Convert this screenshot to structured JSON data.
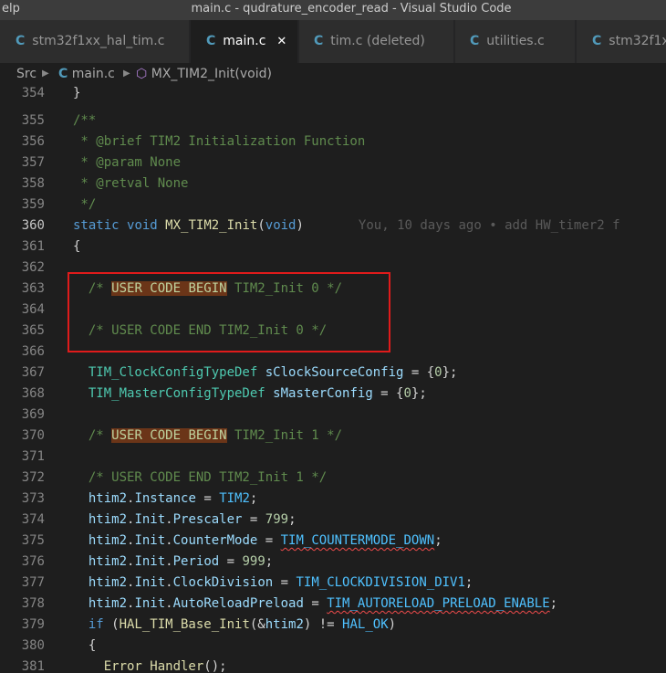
{
  "titlebar": {
    "menu_fragment": "elp",
    "window_title": "main.c - qudrature_encoder_read - Visual Studio Code"
  },
  "tabs": [
    {
      "label": "stm32f1xx_hal_tim.c",
      "active": false
    },
    {
      "label": "main.c",
      "active": true,
      "close": "✕"
    },
    {
      "label": "tim.c (deleted)",
      "active": false
    },
    {
      "label": "utilities.c",
      "active": false
    },
    {
      "label": "stm32f1x",
      "active": false
    }
  ],
  "breadcrumb": {
    "folder": "Src",
    "file": "main.c",
    "symbol": "MX_TIM2_Init(void)"
  },
  "icons": {
    "file_icon": "c-file-icon",
    "symbol_icon": "method-cube-icon",
    "separator": "chevron-right-icon"
  },
  "editor": {
    "current_line": "360",
    "blame": "You, 10 days ago • add HW_timer2 f",
    "lines": [
      {
        "n": "354",
        "text": "}"
      },
      {
        "n": "355",
        "text": "/**"
      },
      {
        "n": "356",
        "text": " * @brief TIM2 Initialization Function"
      },
      {
        "n": "357",
        "text": " * @param None"
      },
      {
        "n": "358",
        "text": " * @retval None"
      },
      {
        "n": "359",
        "text": " */"
      },
      {
        "n": "360",
        "text": "static void MX_TIM2_Init(void)"
      },
      {
        "n": "361",
        "text": "{"
      },
      {
        "n": "362",
        "text": ""
      },
      {
        "n": "363",
        "text": "  /* USER CODE BEGIN TIM2_Init 0 */"
      },
      {
        "n": "364",
        "text": ""
      },
      {
        "n": "365",
        "text": "  /* USER CODE END TIM2_Init 0 */"
      },
      {
        "n": "366",
        "text": ""
      },
      {
        "n": "367",
        "text": "  TIM_ClockConfigTypeDef sClockSourceConfig = {0};"
      },
      {
        "n": "368",
        "text": "  TIM_MasterConfigTypeDef sMasterConfig = {0};"
      },
      {
        "n": "369",
        "text": ""
      },
      {
        "n": "370",
        "text": "  /* USER CODE BEGIN TIM2_Init 1 */"
      },
      {
        "n": "371",
        "text": ""
      },
      {
        "n": "372",
        "text": "  /* USER CODE END TIM2_Init 1 */"
      },
      {
        "n": "373",
        "text": "  htim2.Instance = TIM2;"
      },
      {
        "n": "374",
        "text": "  htim2.Init.Prescaler = 799;"
      },
      {
        "n": "375",
        "text": "  htim2.Init.CounterMode = TIM_COUNTERMODE_DOWN;"
      },
      {
        "n": "376",
        "text": "  htim2.Init.Period = 999;"
      },
      {
        "n": "377",
        "text": "  htim2.Init.ClockDivision = TIM_CLOCKDIVISION_DIV1;"
      },
      {
        "n": "378",
        "text": "  htim2.Init.AutoReloadPreload = TIM_AUTORELOAD_PRELOAD_ENABLE;"
      },
      {
        "n": "379",
        "text": "  if (HAL_TIM_Base_Init(&htim2) != HAL_OK)"
      },
      {
        "n": "380",
        "text": "  {"
      },
      {
        "n": "381",
        "text": "    Error_Handler();"
      }
    ]
  },
  "colors": {
    "annotation_box": "#e01b1b",
    "highlight": "#6b3518",
    "comment": "#608b4e",
    "keyword": "#569cd6"
  }
}
